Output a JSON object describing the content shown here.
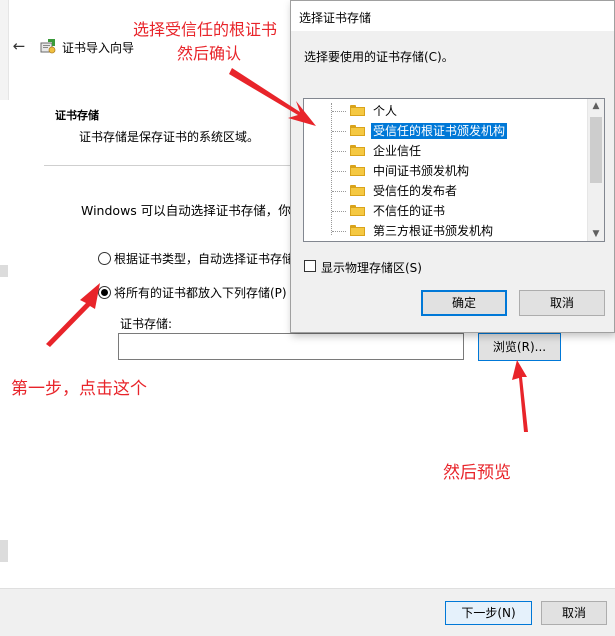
{
  "wizard": {
    "title": "证书导入向导",
    "section_title": "证书存储",
    "section_desc": "证书存储是保存证书的系统区域。",
    "windows_desc": "Windows 可以自动选择证书存储，你也",
    "radio_auto": "根据证书类型，自动选择证书存储",
    "radio_manual": "将所有的证书都放入下列存储(P)",
    "store_label": "证书存储:",
    "store_value": "",
    "browse_label": "浏览(R)...",
    "next_label": "下一步(N)",
    "cancel_label": "取消"
  },
  "dialog": {
    "title": "选择证书存储",
    "prompt": "选择要使用的证书存储(C)。",
    "tree_items": [
      {
        "label": "个人",
        "selected": false
      },
      {
        "label": "受信任的根证书颁发机构",
        "selected": true
      },
      {
        "label": "企业信任",
        "selected": false
      },
      {
        "label": "中间证书颁发机构",
        "selected": false
      },
      {
        "label": "受信任的发布者",
        "selected": false
      },
      {
        "label": "不信任的证书",
        "selected": false
      },
      {
        "label": "第三方根证书颁发机构",
        "selected": false
      }
    ],
    "show_physical_label": "显示物理存储区(S)",
    "show_physical_checked": false,
    "ok_label": "确定",
    "cancel_label": "取消"
  },
  "annotations": {
    "note_select_line1": "选择受信任的根证书",
    "note_select_line2": "然后确认",
    "note_step1": "第一步，点击这个",
    "note_browse": "然后预览"
  },
  "colors": {
    "annotation": "#e8242a",
    "selection": "#0078d7",
    "folder": "#f5c842"
  }
}
